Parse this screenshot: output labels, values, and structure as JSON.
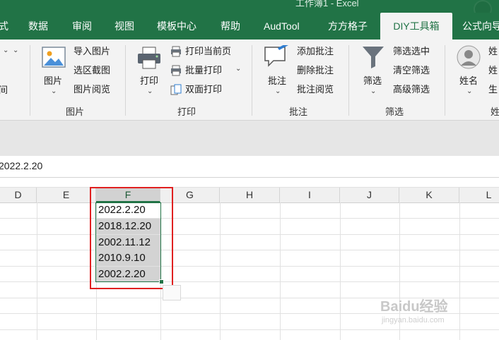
{
  "title": {
    "text": "工作簿1 - Excel"
  },
  "tabs": [
    {
      "label": "式"
    },
    {
      "label": "数据"
    },
    {
      "label": "审阅"
    },
    {
      "label": "视图"
    },
    {
      "label": "模板中心"
    },
    {
      "label": "帮助"
    },
    {
      "label": "AudTool"
    },
    {
      "label": "方方格子"
    },
    {
      "label": "DIY工具箱",
      "active": true
    },
    {
      "label": "公式向导"
    }
  ],
  "ribbon": {
    "picture_group": {
      "label": "图片",
      "picture_button": "图片",
      "import_picture": "导入图片",
      "range_screenshot": "选区截图",
      "picture_browse": "图片阅览"
    },
    "print_group": {
      "label": "打印",
      "print_button": "打印",
      "print_current_page": "打印当前页",
      "batch_print": "批量打印",
      "duplex_print": "双面打印"
    },
    "comment_group": {
      "label": "批注",
      "comment_button": "批注",
      "add_comment": "添加批注",
      "delete_comment": "删除批注",
      "comment_browse": "批注阅览"
    },
    "filter_group": {
      "label": "筛选",
      "filter_button": "筛选",
      "filter_selected": "筛选选中",
      "clear_filter": "清空筛选",
      "advanced_filter": "高级筛选"
    },
    "name_group": {
      "label": "姓",
      "name_button": "姓名",
      "item1": "姓",
      "item2": "姓",
      "item3": "生"
    },
    "left_partial": {
      "item": "间"
    }
  },
  "formula_bar": {
    "value": "2022.2.20"
  },
  "columns": [
    "D",
    "E",
    "F",
    "G",
    "H",
    "I",
    "J",
    "K",
    "L"
  ],
  "cells": [
    "2022.2.20",
    "2018.12.20",
    "2002.11.12",
    "2010.9.10",
    "2002.2.20"
  ],
  "watermark": {
    "logo": "Baidu经验",
    "url": "jingyan.baidu.com"
  }
}
